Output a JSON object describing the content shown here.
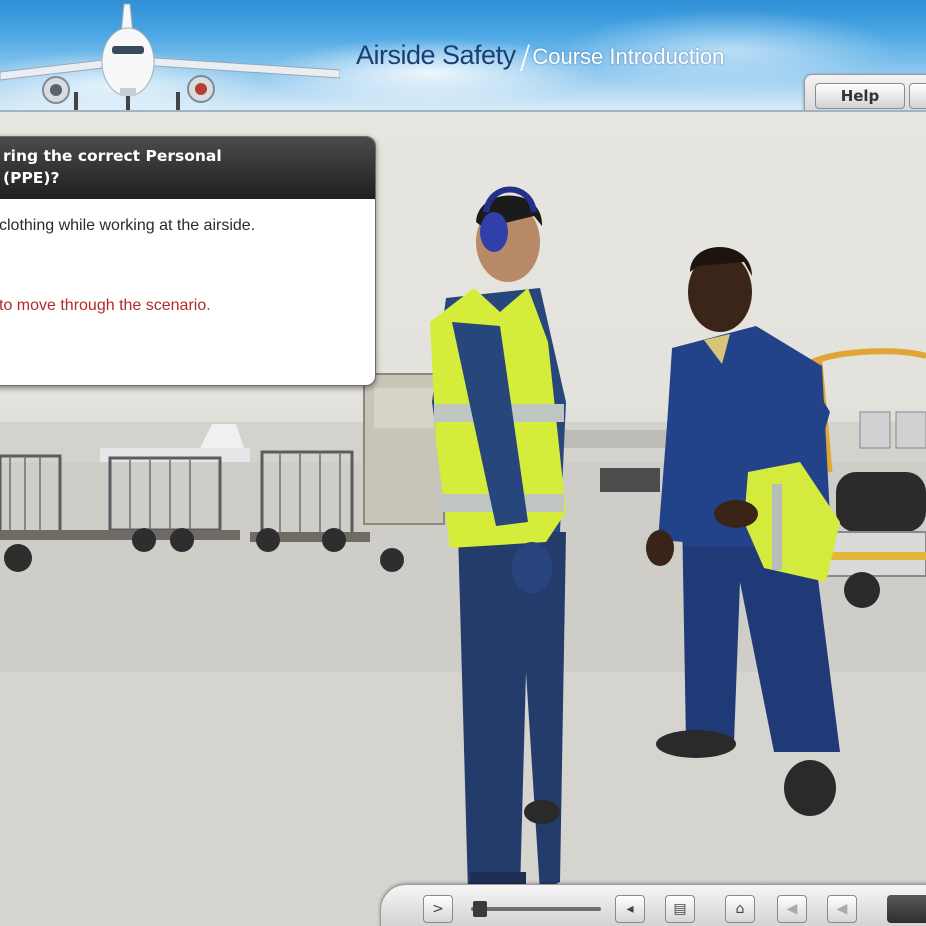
{
  "header": {
    "course_title": "Airside Safety",
    "section_title": "Course Introduction",
    "help_label": "Help"
  },
  "panel": {
    "question_line1": "ring the correct Personal",
    "question_line2": " (PPE)?",
    "body_text": "clothing while working at the airside.",
    "instruction": "to move through the scenario."
  },
  "controls": {
    "play_icon": "play-icon",
    "volume_icon": "volume-icon",
    "transcript_icon": "document-icon",
    "home_icon": "home-icon",
    "back_icon": "back-icon",
    "previous_icon": "previous-icon",
    "progress": 0.02
  },
  "colors": {
    "title_blue": "#1b3f73",
    "instruction_red": "#b32a2a",
    "panel_header": "#2b2b2b",
    "vest_yellow": "#d6ec3a",
    "uniform_blue": "#1f3f7a"
  }
}
